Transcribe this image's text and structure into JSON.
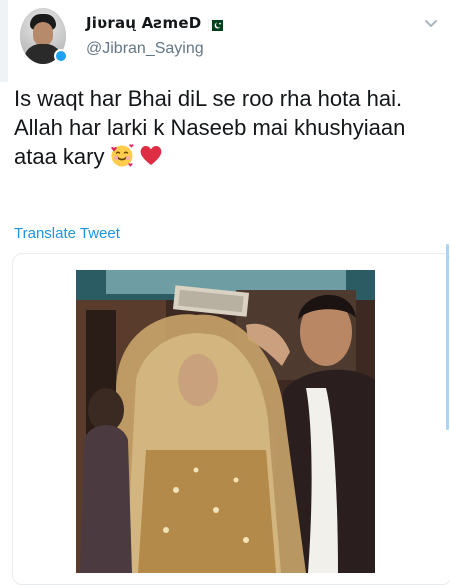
{
  "author": {
    "display_name": "Jiʋraų AƨmeD",
    "handle": "@Jibran_Saying",
    "flag_icon": "pakistan-flag-icon",
    "verified_icon": "verified-badge-icon"
  },
  "tweet": {
    "line1": "Is waqt har Bhai diL se roo rha hota hai.",
    "line2": "Allah har larki k Naseeb mai khushyiaan ataa kary",
    "emojis": [
      "smiling-face-with-hearts-emoji",
      "red-heart-emoji"
    ]
  },
  "actions": {
    "translate_label": "Translate Tweet",
    "more_icon": "chevron-down-icon"
  },
  "media": {
    "description_icon": "wedding-photo"
  },
  "colors": {
    "link": "#1b95e0",
    "text": "#14171a",
    "secondary": "#657786"
  }
}
